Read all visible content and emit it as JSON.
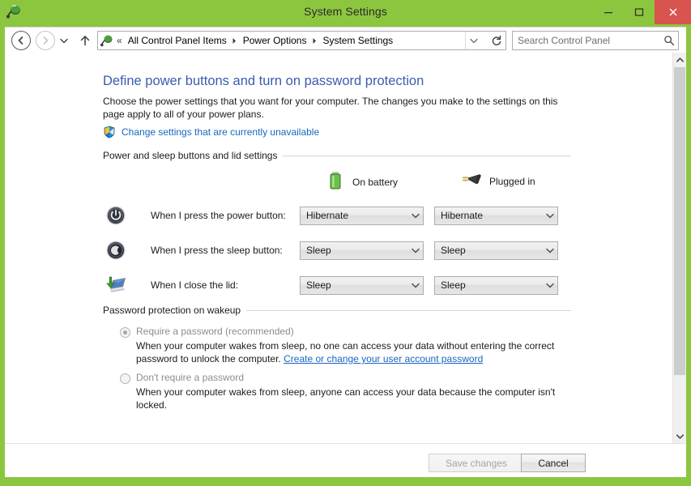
{
  "window": {
    "title": "System Settings",
    "icon": "power-options-icon",
    "controls": {
      "minimize": "minimize-button",
      "maximize": "maximize-button",
      "close": "close-button",
      "close_color": "#D9534F"
    },
    "chrome_color": "#8CC63E"
  },
  "nav": {
    "back": "back-button",
    "forward": "forward-button",
    "recent": "recent-locations-button",
    "up": "up-button",
    "breadcrumb": {
      "icon": "control-panel-icon",
      "overflow": "«",
      "items": [
        {
          "label": "All Control Panel Items"
        },
        {
          "label": "Power Options"
        },
        {
          "label": "System Settings"
        }
      ],
      "dropdown": "address-dropdown",
      "refresh": "refresh-button"
    },
    "search": {
      "placeholder": "Search Control Panel",
      "value": "",
      "icon": "search-icon"
    }
  },
  "page": {
    "title": "Define power buttons and turn on password protection",
    "description": "Choose the power settings that you want for your computer. The changes you make to the settings on this page apply to all of your power plans.",
    "uac_link": "Change settings that are currently unavailable",
    "uac_icon": "uac-shield-icon",
    "link_color": "#1667C1",
    "title_color": "#3A5DAE"
  },
  "power_section": {
    "group_label": "Power and sleep buttons and lid settings",
    "columns": [
      {
        "id": "battery",
        "label": "On battery",
        "icon": "battery-icon"
      },
      {
        "id": "plugged",
        "label": "Plugged in",
        "icon": "power-plug-icon"
      }
    ],
    "rows": [
      {
        "icon": "power-button-icon",
        "label": "When I press the power button:",
        "battery_value": "Hibernate",
        "plugged_value": "Hibernate"
      },
      {
        "icon": "sleep-button-icon",
        "label": "When I press the sleep button:",
        "battery_value": "Sleep",
        "plugged_value": "Sleep"
      },
      {
        "icon": "laptop-lid-icon",
        "label": "When I close the lid:",
        "battery_value": "Sleep",
        "plugged_value": "Sleep"
      }
    ]
  },
  "password_section": {
    "group_label": "Password protection on wakeup",
    "options": [
      {
        "label": "Require a password (recommended)",
        "selected": true,
        "description_before": "When your computer wakes from sleep, no one can access your data without entering the correct password to unlock the computer. ",
        "link": "Create or change your user account password",
        "description_after": ""
      },
      {
        "label": "Don't require a password",
        "selected": false,
        "description_before": "When your computer wakes from sleep, anyone can access your data because the computer isn't locked.",
        "link": "",
        "description_after": ""
      }
    ]
  },
  "footer": {
    "save_label": "Save changes",
    "save_disabled": true,
    "cancel_label": "Cancel",
    "cancel_disabled": false
  },
  "scrollbar": {
    "up_arrow": "scroll-up-arrow",
    "down_arrow": "scroll-down-arrow",
    "thumb": "scroll-thumb"
  }
}
